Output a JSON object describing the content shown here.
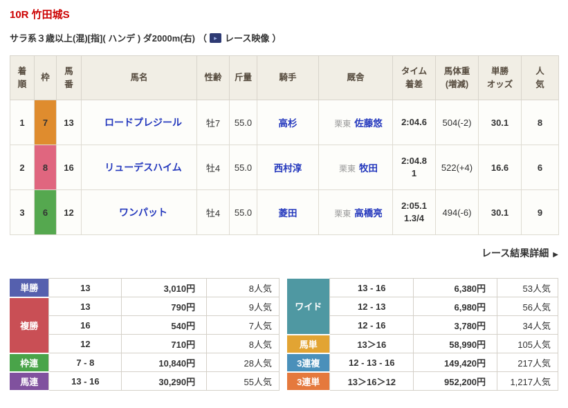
{
  "header": {
    "title": "10R 竹田城S",
    "conditions": "サラ系３歳以上(混)[指]( ハンデ ) ダ2000m(右)",
    "video_open": "（",
    "video_label": "レース映像",
    "video_close": "）",
    "video_icon": "▸"
  },
  "results": {
    "columns": [
      "着\n順",
      "枠",
      "馬\n番",
      "馬名",
      "性齢",
      "斤量",
      "騎手",
      "厩舎",
      "タイム\n着差",
      "馬体重\n(増減)",
      "単勝\nオッズ",
      "人\n気"
    ],
    "rows": [
      {
        "rank": "1",
        "waku": "7",
        "waku_color": "#df8c2e",
        "num": "13",
        "name": "ロードプレジール",
        "sex_age": "牡7",
        "weight": "55.0",
        "jockey": "高杉",
        "stable_area": "栗東",
        "stable_name": "佐藤悠",
        "time": "2:04.6",
        "margin": "",
        "horse_weight": "504(-2)",
        "odds": "30.1",
        "pop": "8"
      },
      {
        "rank": "2",
        "waku": "8",
        "waku_color": "#e0667f",
        "num": "16",
        "name": "リューデスハイム",
        "sex_age": "牡4",
        "weight": "55.0",
        "jockey": "西村淳",
        "stable_area": "栗東",
        "stable_name": "牧田",
        "time": "2:04.8",
        "margin": "1",
        "horse_weight": "522(+4)",
        "odds": "16.6",
        "pop": "6"
      },
      {
        "rank": "3",
        "waku": "6",
        "waku_color": "#55a84f",
        "num": "12",
        "name": "ワンパット",
        "sex_age": "牡4",
        "weight": "55.0",
        "jockey": "菱田",
        "stable_area": "栗東",
        "stable_name": "高橋亮",
        "time": "2:05.1",
        "margin": "1.3/4",
        "horse_weight": "494(-6)",
        "odds": "30.1",
        "pop": "9"
      }
    ]
  },
  "detail_link": {
    "label": "レース結果詳細",
    "arrow": "▶"
  },
  "payouts": {
    "left": [
      {
        "label": "単勝",
        "color": "#5560ae",
        "rows": [
          [
            "13",
            "3,010円",
            "8人気"
          ]
        ]
      },
      {
        "label": "複勝",
        "color": "#c94f55",
        "rows": [
          [
            "13",
            "790円",
            "9人気"
          ],
          [
            "16",
            "540円",
            "7人気"
          ],
          [
            "12",
            "710円",
            "8人気"
          ]
        ]
      },
      {
        "label": "枠連",
        "color": "#49a449",
        "rows": [
          [
            "7 - 8",
            "10,840円",
            "28人気"
          ]
        ]
      },
      {
        "label": "馬連",
        "color": "#80519e",
        "rows": [
          [
            "13 - 16",
            "30,290円",
            "55人気"
          ]
        ]
      }
    ],
    "right": [
      {
        "label": "ワイド",
        "color": "#4f98a2",
        "rows": [
          [
            "13 - 16",
            "6,380円",
            "53人気"
          ],
          [
            "12 - 13",
            "6,980円",
            "56人気"
          ],
          [
            "12 - 16",
            "3,780円",
            "34人気"
          ]
        ]
      },
      {
        "label": "馬単",
        "color": "#e2a433",
        "rows": [
          [
            "13＞16",
            "58,990円",
            "105人気"
          ]
        ]
      },
      {
        "label": "3連複",
        "color": "#4a90ba",
        "rows": [
          [
            "12 - 13 - 16",
            "149,420円",
            "217人気"
          ]
        ]
      },
      {
        "label": "3連単",
        "color": "#e5793d",
        "rows": [
          [
            "13＞16＞12",
            "952,200円",
            "1,217人気"
          ]
        ]
      }
    ]
  },
  "colors": {
    "title_red": "#cc0000",
    "link_blue": "#2438bd",
    "table_header_bg": "#f1eee5"
  }
}
